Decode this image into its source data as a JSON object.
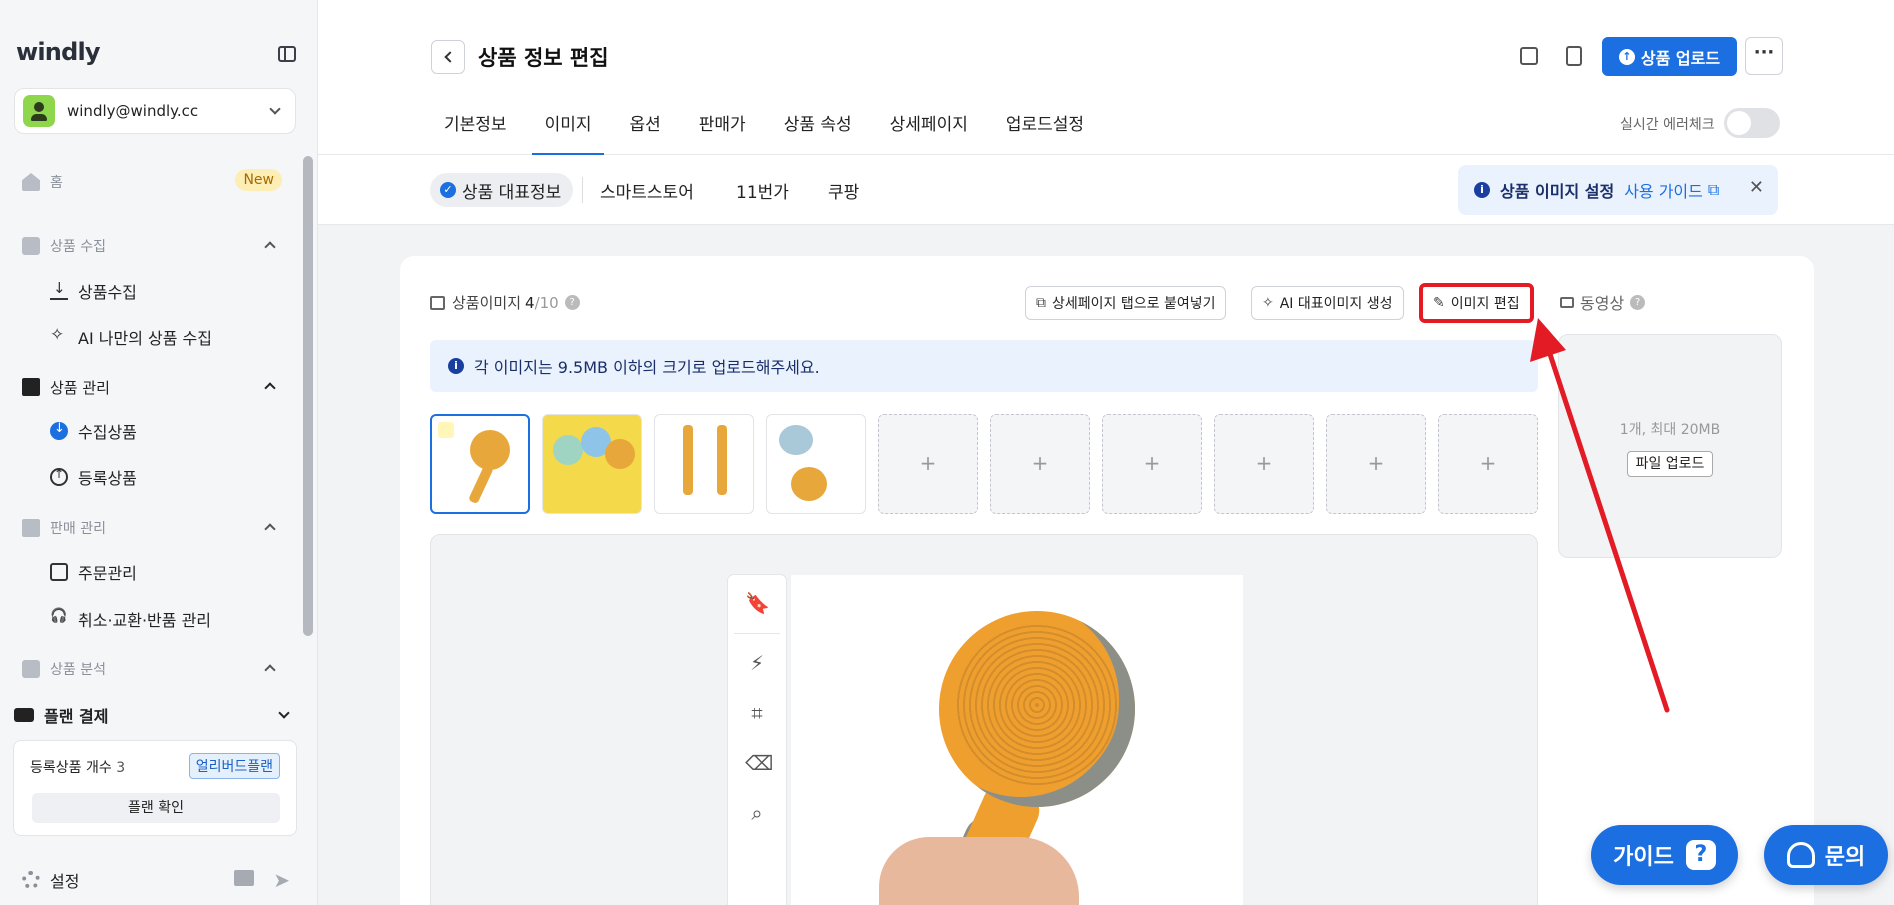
{
  "sidebar": {
    "logo": "windly",
    "account": {
      "email": "windly@windly.cc"
    },
    "home": {
      "label": "홈",
      "badge": "New"
    },
    "sections": [
      {
        "label": "상품 수집",
        "items": [
          "상품수집",
          "AI 나만의 상품 수집"
        ]
      },
      {
        "label": "상품 관리",
        "items": [
          "수집상품",
          "등록상품"
        ]
      },
      {
        "label": "판매 관리",
        "items": [
          "주문관리",
          "취소·교환·반품 관리"
        ]
      },
      {
        "label": "상품 분석",
        "items": []
      }
    ],
    "plan": {
      "label": "플랜 결제",
      "count_label": "등록상품 개수",
      "count_value": "3",
      "tag": "얼리버드플랜",
      "button": "플랜 확인"
    },
    "settings_label": "설정"
  },
  "header": {
    "title": "상품 정보 편집",
    "upload_button": "상품 업로드",
    "more": "···",
    "tabs": [
      "기본정보",
      "이미지",
      "옵션",
      "판매가",
      "상품 속성",
      "상세페이지",
      "업로드설정"
    ],
    "active_tab": "이미지",
    "live_check_label": "실시간 에러체크"
  },
  "subtabs": {
    "items": [
      "상품 대표정보",
      "스마트스토어",
      "11번가",
      "쿠팡"
    ],
    "check": "✓",
    "guide": {
      "title": "상품 이미지 설정",
      "link": "사용 가이드",
      "close": "✕"
    }
  },
  "images": {
    "section_label": "상품이미지",
    "count": "4",
    "max": "/10",
    "help": "?",
    "buttons": {
      "paste": "상세페이지 탭으로 붙여넣기",
      "ai": "AI 대표이미지 생성",
      "edit": "이미지 편집"
    },
    "notice": "각 이미지는 9.5MB 이하의 크기로 업로드해주세요.",
    "notice_icon": "i",
    "empty_slot": "+"
  },
  "video": {
    "label": "동영상",
    "help": "?",
    "hint": "1개, 최대 20MB",
    "button": "파일 업로드"
  },
  "fabs": {
    "guide": "가이드",
    "guide_icon": "?",
    "ask": "문의"
  },
  "colors": {
    "accent": "#1b6fe0",
    "highlight": "#e21b25"
  }
}
